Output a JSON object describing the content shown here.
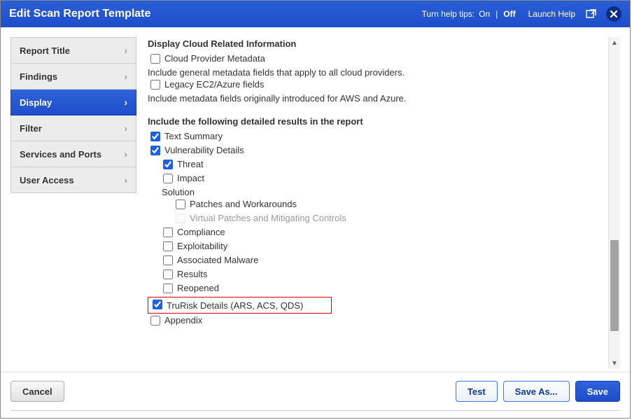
{
  "header": {
    "title": "Edit Scan Report Template",
    "help_tips_label": "Turn help tips:",
    "on_label": "On",
    "off_label": "Off",
    "launch_help": "Launch Help"
  },
  "sidebar": {
    "items": [
      {
        "label": "Report Title"
      },
      {
        "label": "Findings"
      },
      {
        "label": "Display"
      },
      {
        "label": "Filter"
      },
      {
        "label": "Services and Ports"
      },
      {
        "label": "User Access"
      }
    ],
    "active_index": 2
  },
  "main": {
    "cloud_section_title": "Display Cloud Related Information",
    "cloud_provider_metadata": "Cloud Provider Metadata",
    "cloud_provider_metadata_desc": "Include general metadata fields that apply to all cloud providers.",
    "legacy_ec2": "Legacy EC2/Azure fields",
    "legacy_ec2_desc": "Include metadata fields originally introduced for AWS and Azure.",
    "detailed_title": "Include the following detailed results in the report",
    "text_summary": "Text Summary",
    "vuln_details": "Vulnerability Details",
    "threat": "Threat",
    "impact": "Impact",
    "solution": "Solution",
    "patches": "Patches and Workarounds",
    "virtual_patches": "Virtual Patches and Mitigating Controls",
    "compliance": "Compliance",
    "exploitability": "Exploitability",
    "associated_malware": "Associated Malware",
    "results": "Results",
    "reopened": "Reopened",
    "trurisk": "TruRisk Details (ARS, ACS, QDS)",
    "appendix": "Appendix"
  },
  "footer": {
    "cancel": "Cancel",
    "test": "Test",
    "save_as": "Save As...",
    "save": "Save"
  }
}
